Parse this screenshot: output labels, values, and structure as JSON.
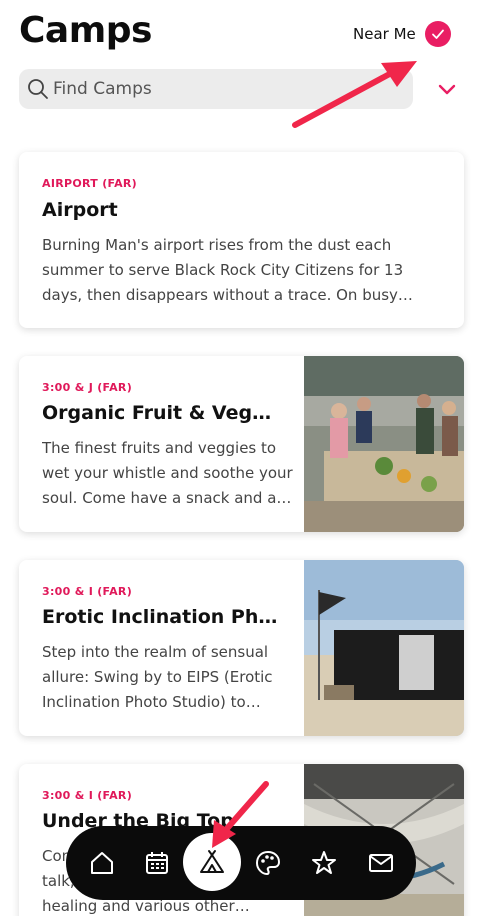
{
  "header": {
    "title": "Camps",
    "near_me_label": "Near Me",
    "near_me_checked": true,
    "accent_color": "#e91e63"
  },
  "search": {
    "placeholder": "Find Camps",
    "value": ""
  },
  "camps": [
    {
      "location": "AIRPORT (FAR)",
      "name": "Airport",
      "description": "Burning Man's airport rises from the dust each summer to serve Black Rock City Citizens for 13 days, then disappears without a trace. On busy days, planes land every few minutes.",
      "has_image": false
    },
    {
      "location": "3:00 & J (FAR)",
      "name": "Organic Fruit & Veggie Bar",
      "description": "The finest fruits and veggies to wet your whistle and soothe your soul. Come have a snack and a chat with us.",
      "has_image": true,
      "image_desc": "People gathered around a long table of fruit under shade"
    },
    {
      "location": "3:00 & I (FAR)",
      "name": "Erotic Inclination Photo Studio",
      "description": "Step into the realm of sensual allure: Swing by to EIPS (Erotic Inclination Photo Studio) to capture your moment.",
      "has_image": true,
      "image_desc": "Black tent structure with a flag on the playa"
    },
    {
      "location": "3:00 & I (FAR)",
      "name": "Under the Big Top",
      "description": "Come relax under the big top, talk, sip tea and enjoy energy healing and various other offerings.",
      "has_image": true,
      "image_desc": "Shade structure with hammocks under a canopy"
    }
  ],
  "tabs": [
    {
      "name": "home",
      "icon": "home-icon",
      "active": false
    },
    {
      "name": "calendar",
      "icon": "calendar-icon",
      "active": false
    },
    {
      "name": "camps",
      "icon": "tent-icon",
      "active": true
    },
    {
      "name": "art",
      "icon": "palette-icon",
      "active": false
    },
    {
      "name": "favorites",
      "icon": "star-icon",
      "active": false
    },
    {
      "name": "messages",
      "icon": "mail-icon",
      "active": false
    }
  ],
  "annotation_color": "#f0264a"
}
